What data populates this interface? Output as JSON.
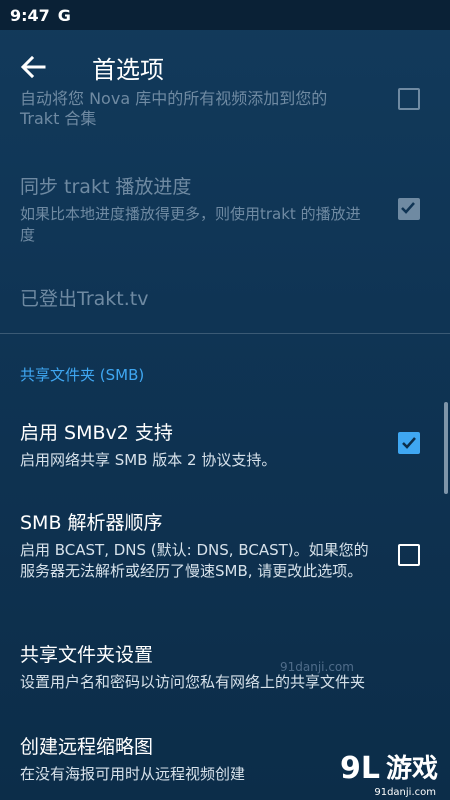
{
  "status_bar": {
    "time": "9:47",
    "app_badge": "G"
  },
  "app_bar": {
    "title": "首选项"
  },
  "prefs": {
    "partial": {
      "title": "自动将您 Nova 库中的所有视频添加到您的",
      "summary": "Trakt 合集"
    },
    "sync_progress": {
      "title": "同步 trakt 播放进度",
      "summary": "如果比本地进度播放得更多，则使用trakt 的播放进度",
      "checked": true,
      "enabled": false
    },
    "logged_out": {
      "title": "已登出Trakt.tv"
    }
  },
  "smb_section": {
    "category": "共享文件夹 (SMB)",
    "items": [
      {
        "title": "启用 SMBv2 支持",
        "summary": "启用网络共享 SMB 版本 2 协议支持。",
        "checked": true
      },
      {
        "title": "SMB 解析器顺序",
        "summary": "启用 BCAST, DNS (默认: DNS, BCAST)。如果您的服务器无法解析或经历了慢速SMB, 请更改此选项。",
        "checked": false
      },
      {
        "title": "共享文件夹设置",
        "summary": "设置用户名和密码以访问您私有网络上的共享文件夹"
      },
      {
        "title": "创建远程缩略图",
        "summary": "在没有海报可用时从远程视频创建"
      }
    ]
  },
  "watermark": {
    "text": "91danji.com"
  },
  "logo": {
    "mark": "9L",
    "name": "游戏",
    "domain": "91danji.com"
  },
  "colors": {
    "accent": "#3fa7f2",
    "background": "#0f3454"
  }
}
